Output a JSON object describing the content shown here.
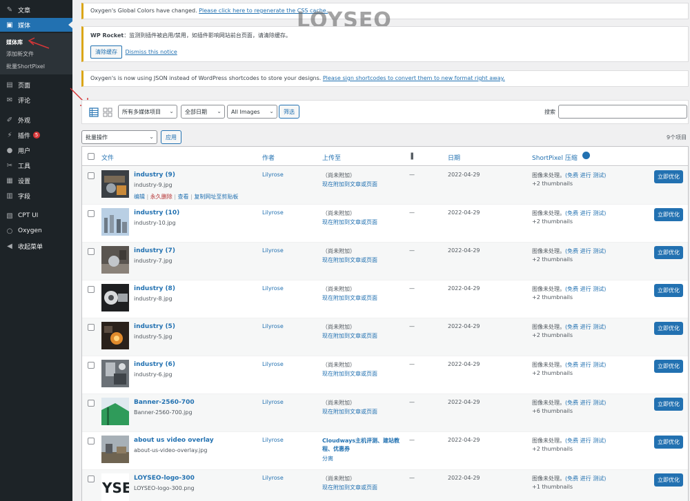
{
  "sidebar": {
    "items": [
      {
        "label": "文章",
        "icon": "pin-icon"
      },
      {
        "label": "媒体",
        "icon": "media-icon"
      },
      {
        "label": "页面",
        "icon": "page-icon"
      },
      {
        "label": "评论",
        "icon": "comment-icon"
      },
      {
        "label": "外观",
        "icon": "brush-icon"
      },
      {
        "label": "插件",
        "icon": "plugin-icon",
        "badge": "5"
      },
      {
        "label": "用户",
        "icon": "user-icon"
      },
      {
        "label": "工具",
        "icon": "wrench-icon"
      },
      {
        "label": "设置",
        "icon": "settings-icon"
      },
      {
        "label": "字段",
        "icon": "fields-icon"
      },
      {
        "label": "CPT UI",
        "icon": "cpt-icon"
      },
      {
        "label": "Oxygen",
        "icon": "oxygen-icon"
      },
      {
        "label": "收起菜单",
        "icon": "collapse-icon"
      }
    ],
    "submenu": [
      "媒体库",
      "添加新文件",
      "批量ShortPixel"
    ]
  },
  "notices": {
    "oxygen_colors": {
      "text": "Oxygen's Global Colors have changed. ",
      "link": "Please click here to regenerate the CSS cache."
    },
    "wp_rocket": {
      "title": "WP Rocket",
      "text": "：监测到插件被启用/禁用，如插件影响网站前台页面，请清除缓存。",
      "button": "清除缓存",
      "dismiss": "Dismiss this notice"
    },
    "oxygen_json": {
      "text": "Oxygen's is now using JSON instead of WordPress shortcodes to store your designs. ",
      "link": "Please sign shortcodes to convert them to new format right away."
    }
  },
  "watermark": "LOYSEO",
  "toolbar": {
    "filter_type": "所有多媒体项目",
    "filter_date": "全部日期",
    "filter_plugin": "All Images",
    "filter_button": "筛选",
    "search_label": "搜索",
    "search_value": ""
  },
  "bulk": {
    "select": "批量操作",
    "apply": "应用",
    "count": "9个项目"
  },
  "table": {
    "headers": {
      "file": "文件",
      "author": "作者",
      "uploaded_to": "上传至",
      "date": "日期",
      "shortpixel": "ShortPixel 压缩"
    },
    "row_actions": {
      "edit": "编辑",
      "delete": "永久删除",
      "view": "查看",
      "copy": "复制网址至剪贴板"
    },
    "rows": [
      {
        "title": "industry (9)",
        "file": "industry-9.jpg",
        "author": "Lilyrose",
        "up1": "（尚未附加）",
        "up2": "现在附加到文章或页面",
        "up3": "",
        "comments": "—",
        "date": "2022-04-29",
        "sp_status": "图像未处理。",
        "sp_link": "(免费 进行 测试)",
        "sp_thumbs": "+2 thumbnails",
        "button": "立即优化"
      },
      {
        "title": "industry (10)",
        "file": "industry-10.jpg",
        "author": "Lilyrose",
        "up1": "（尚未附加）",
        "up2": "现在附加到文章或页面",
        "up3": "",
        "comments": "—",
        "date": "2022-04-29",
        "sp_status": "图像未处理。",
        "sp_link": "(免费 进行 测试)",
        "sp_thumbs": "+2 thumbnails",
        "button": "立即优化"
      },
      {
        "title": "industry (7)",
        "file": "industry-7.jpg",
        "author": "Lilyrose",
        "up1": "（尚未附加）",
        "up2": "现在附加到文章或页面",
        "up3": "",
        "comments": "—",
        "date": "2022-04-29",
        "sp_status": "图像未处理。",
        "sp_link": "(免费 进行 测试)",
        "sp_thumbs": "+2 thumbnails",
        "button": "立即优化"
      },
      {
        "title": "industry (8)",
        "file": "industry-8.jpg",
        "author": "Lilyrose",
        "up1": "（尚未附加）",
        "up2": "现在附加到文章或页面",
        "up3": "",
        "comments": "—",
        "date": "2022-04-29",
        "sp_status": "图像未处理。",
        "sp_link": "(免费 进行 测试)",
        "sp_thumbs": "+2 thumbnails",
        "button": "立即优化"
      },
      {
        "title": "industry (5)",
        "file": "industry-5.jpg",
        "author": "Lilyrose",
        "up1": "（尚未附加）",
        "up2": "现在附加到文章或页面",
        "up3": "",
        "comments": "—",
        "date": "2022-04-29",
        "sp_status": "图像未处理。",
        "sp_link": "(免费 进行 测试)",
        "sp_thumbs": "+2 thumbnails",
        "button": "立即优化"
      },
      {
        "title": "industry (6)",
        "file": "industry-6.jpg",
        "author": "Lilyrose",
        "up1": "（尚未附加）",
        "up2": "现在附加到文章或页面",
        "up3": "",
        "comments": "—",
        "date": "2022-04-29",
        "sp_status": "图像未处理。",
        "sp_link": "(免费 进行 测试)",
        "sp_thumbs": "+2 thumbnails",
        "button": "立即优化"
      },
      {
        "title": "Banner-2560-700",
        "file": "Banner-2560-700.jpg",
        "author": "Lilyrose",
        "up1": "（尚未附加）",
        "up2": "现在附加到文章或页面",
        "up3": "",
        "comments": "—",
        "date": "2022-04-29",
        "sp_status": "图像未处理。",
        "sp_link": "(免费 进行 测试)",
        "sp_thumbs": "+6 thumbnails",
        "button": "立即优化"
      },
      {
        "title": "about us video overlay",
        "file": "about-us-video-overlay.jpg",
        "author": "Lilyrose",
        "up1": "Cloudways主机评测、建站教程、优惠券",
        "up2": "分离",
        "up3": "",
        "comments": "—",
        "date": "2022-04-29",
        "sp_status": "图像未处理。",
        "sp_link": "(免费 进行 测试)",
        "sp_thumbs": "+2 thumbnails",
        "button": "立即优化"
      },
      {
        "title": "LOYSEO-logo-300",
        "file": "LOYSEO-logo-300.png",
        "author": "Lilyrose",
        "up1": "（尚未附加）",
        "up2": "现在附加到文章或页面",
        "up3": "",
        "comments": "—",
        "date": "2022-04-29",
        "sp_status": "图像未处理。",
        "sp_link": "(免费 进行 测试)",
        "sp_thumbs": "+1 thumbnails",
        "button": "立即优化"
      }
    ]
  },
  "colors": {
    "accent": "#2271b1",
    "sidebar": "#1d2327",
    "annotation": "#d63638"
  }
}
